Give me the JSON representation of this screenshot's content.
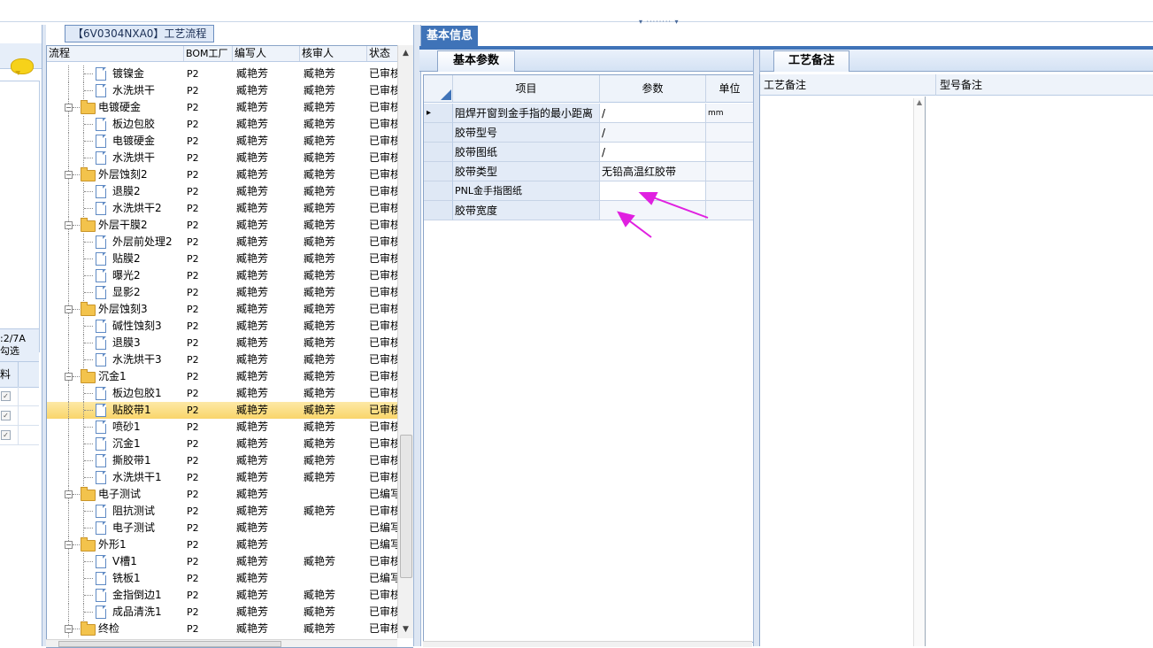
{
  "tree_panel": {
    "caption": "【6V0304NXA0】工艺流程",
    "columns": [
      "流程",
      "BOM工厂",
      "编写人",
      "核审人",
      "状态"
    ],
    "rows": [
      {
        "level": 1,
        "type": "doc",
        "name": "镀镍金",
        "bom": "P2",
        "writer": "臧艳芳",
        "reviewer": "臧艳芳",
        "status": "已审核"
      },
      {
        "level": 1,
        "type": "doc",
        "name": "水洗烘干",
        "bom": "P2",
        "writer": "臧艳芳",
        "reviewer": "臧艳芳",
        "status": "已审核"
      },
      {
        "level": 0,
        "type": "folder",
        "name": "电镀硬金",
        "bom": "P2",
        "writer": "臧艳芳",
        "reviewer": "臧艳芳",
        "status": "已审核"
      },
      {
        "level": 1,
        "type": "doc",
        "name": "板边包胶",
        "bom": "P2",
        "writer": "臧艳芳",
        "reviewer": "臧艳芳",
        "status": "已审核"
      },
      {
        "level": 1,
        "type": "doc",
        "name": "电镀硬金",
        "bom": "P2",
        "writer": "臧艳芳",
        "reviewer": "臧艳芳",
        "status": "已审核"
      },
      {
        "level": 1,
        "type": "doc",
        "name": "水洗烘干",
        "bom": "P2",
        "writer": "臧艳芳",
        "reviewer": "臧艳芳",
        "status": "已审核"
      },
      {
        "level": 0,
        "type": "folder",
        "name": "外层蚀刻2",
        "bom": "P2",
        "writer": "臧艳芳",
        "reviewer": "臧艳芳",
        "status": "已审核"
      },
      {
        "level": 1,
        "type": "doc",
        "name": "退膜2",
        "bom": "P2",
        "writer": "臧艳芳",
        "reviewer": "臧艳芳",
        "status": "已审核"
      },
      {
        "level": 1,
        "type": "doc",
        "name": "水洗烘干2",
        "bom": "P2",
        "writer": "臧艳芳",
        "reviewer": "臧艳芳",
        "status": "已审核"
      },
      {
        "level": 0,
        "type": "folder",
        "name": "外层干膜2",
        "bom": "P2",
        "writer": "臧艳芳",
        "reviewer": "臧艳芳",
        "status": "已审核"
      },
      {
        "level": 1,
        "type": "doc",
        "name": "外层前处理2",
        "bom": "P2",
        "writer": "臧艳芳",
        "reviewer": "臧艳芳",
        "status": "已审核"
      },
      {
        "level": 1,
        "type": "doc",
        "name": "贴膜2",
        "bom": "P2",
        "writer": "臧艳芳",
        "reviewer": "臧艳芳",
        "status": "已审核"
      },
      {
        "level": 1,
        "type": "doc",
        "name": "曝光2",
        "bom": "P2",
        "writer": "臧艳芳",
        "reviewer": "臧艳芳",
        "status": "已审核"
      },
      {
        "level": 1,
        "type": "doc",
        "name": "显影2",
        "bom": "P2",
        "writer": "臧艳芳",
        "reviewer": "臧艳芳",
        "status": "已审核"
      },
      {
        "level": 0,
        "type": "folder",
        "name": "外层蚀刻3",
        "bom": "P2",
        "writer": "臧艳芳",
        "reviewer": "臧艳芳",
        "status": "已审核"
      },
      {
        "level": 1,
        "type": "doc",
        "name": "碱性蚀刻3",
        "bom": "P2",
        "writer": "臧艳芳",
        "reviewer": "臧艳芳",
        "status": "已审核"
      },
      {
        "level": 1,
        "type": "doc",
        "name": "退膜3",
        "bom": "P2",
        "writer": "臧艳芳",
        "reviewer": "臧艳芳",
        "status": "已审核"
      },
      {
        "level": 1,
        "type": "doc",
        "name": "水洗烘干3",
        "bom": "P2",
        "writer": "臧艳芳",
        "reviewer": "臧艳芳",
        "status": "已审核"
      },
      {
        "level": 0,
        "type": "folder",
        "name": "沉金1",
        "bom": "P2",
        "writer": "臧艳芳",
        "reviewer": "臧艳芳",
        "status": "已审核"
      },
      {
        "level": 1,
        "type": "doc",
        "name": "板边包胶1",
        "bom": "P2",
        "writer": "臧艳芳",
        "reviewer": "臧艳芳",
        "status": "已审核"
      },
      {
        "level": 1,
        "type": "doc",
        "name": "贴胶带1",
        "bom": "P2",
        "writer": "臧艳芳",
        "reviewer": "臧艳芳",
        "status": "已审核",
        "selected": true
      },
      {
        "level": 1,
        "type": "doc",
        "name": "喷砂1",
        "bom": "P2",
        "writer": "臧艳芳",
        "reviewer": "臧艳芳",
        "status": "已审核"
      },
      {
        "level": 1,
        "type": "doc",
        "name": "沉金1",
        "bom": "P2",
        "writer": "臧艳芳",
        "reviewer": "臧艳芳",
        "status": "已审核"
      },
      {
        "level": 1,
        "type": "doc",
        "name": "撕胶带1",
        "bom": "P2",
        "writer": "臧艳芳",
        "reviewer": "臧艳芳",
        "status": "已审核"
      },
      {
        "level": 1,
        "type": "doc",
        "name": "水洗烘干1",
        "bom": "P2",
        "writer": "臧艳芳",
        "reviewer": "臧艳芳",
        "status": "已审核"
      },
      {
        "level": 0,
        "type": "folder",
        "name": "电子测试",
        "bom": "P2",
        "writer": "臧艳芳",
        "reviewer": "",
        "status": "已编写"
      },
      {
        "level": 1,
        "type": "doc",
        "name": "阻抗测试",
        "bom": "P2",
        "writer": "臧艳芳",
        "reviewer": "臧艳芳",
        "status": "已审核"
      },
      {
        "level": 1,
        "type": "doc",
        "name": "电子测试",
        "bom": "P2",
        "writer": "臧艳芳",
        "reviewer": "",
        "status": "已编写"
      },
      {
        "level": 0,
        "type": "folder",
        "name": "外形1",
        "bom": "P2",
        "writer": "臧艳芳",
        "reviewer": "",
        "status": "已编写"
      },
      {
        "level": 1,
        "type": "doc",
        "name": "V槽1",
        "bom": "P2",
        "writer": "臧艳芳",
        "reviewer": "臧艳芳",
        "status": "已审核"
      },
      {
        "level": 1,
        "type": "doc",
        "name": "铣板1",
        "bom": "P2",
        "writer": "臧艳芳",
        "reviewer": "",
        "status": "已编写"
      },
      {
        "level": 1,
        "type": "doc",
        "name": "金指倒边1",
        "bom": "P2",
        "writer": "臧艳芳",
        "reviewer": "臧艳芳",
        "status": "已审核"
      },
      {
        "level": 1,
        "type": "doc",
        "name": "成品清洗1",
        "bom": "P2",
        "writer": "臧艳芳",
        "reviewer": "臧艳芳",
        "status": "已审核"
      },
      {
        "level": 0,
        "type": "folder",
        "name": "终检",
        "bom": "P2",
        "writer": "臧艳芳",
        "reviewer": "臧艳芳",
        "status": "已审核"
      }
    ]
  },
  "left_strip": {
    "filter_line1": ":2/7A",
    "filter_line2": "勾选",
    "col_label": "料"
  },
  "basic_info": {
    "tab_label": "基本信息",
    "sub_tab_params": "基本参数",
    "sub_tab_remarks": "工艺备注",
    "param_columns": [
      "项目",
      "参数",
      "单位"
    ],
    "params": [
      {
        "item": "阻焊开窗到金手指的最小距离",
        "value": "/",
        "unit": "mm",
        "current": true
      },
      {
        "item": "胶带型号",
        "value": "/",
        "unit": ""
      },
      {
        "item": "胶带图纸",
        "value": "/",
        "unit": ""
      },
      {
        "item": "胶带类型",
        "value": "无铅高温红胶带",
        "unit": ""
      },
      {
        "item": "PNL金手指图纸",
        "value": "",
        "unit": ""
      },
      {
        "item": "胶带宽度",
        "value": "",
        "unit": ""
      }
    ],
    "remark_columns": [
      "工艺备注",
      "型号备注"
    ]
  },
  "colors": {
    "tab_blue": "#3f73b8",
    "selected_row": "#f9d56a",
    "annotation_arrow": "#e020e0"
  }
}
